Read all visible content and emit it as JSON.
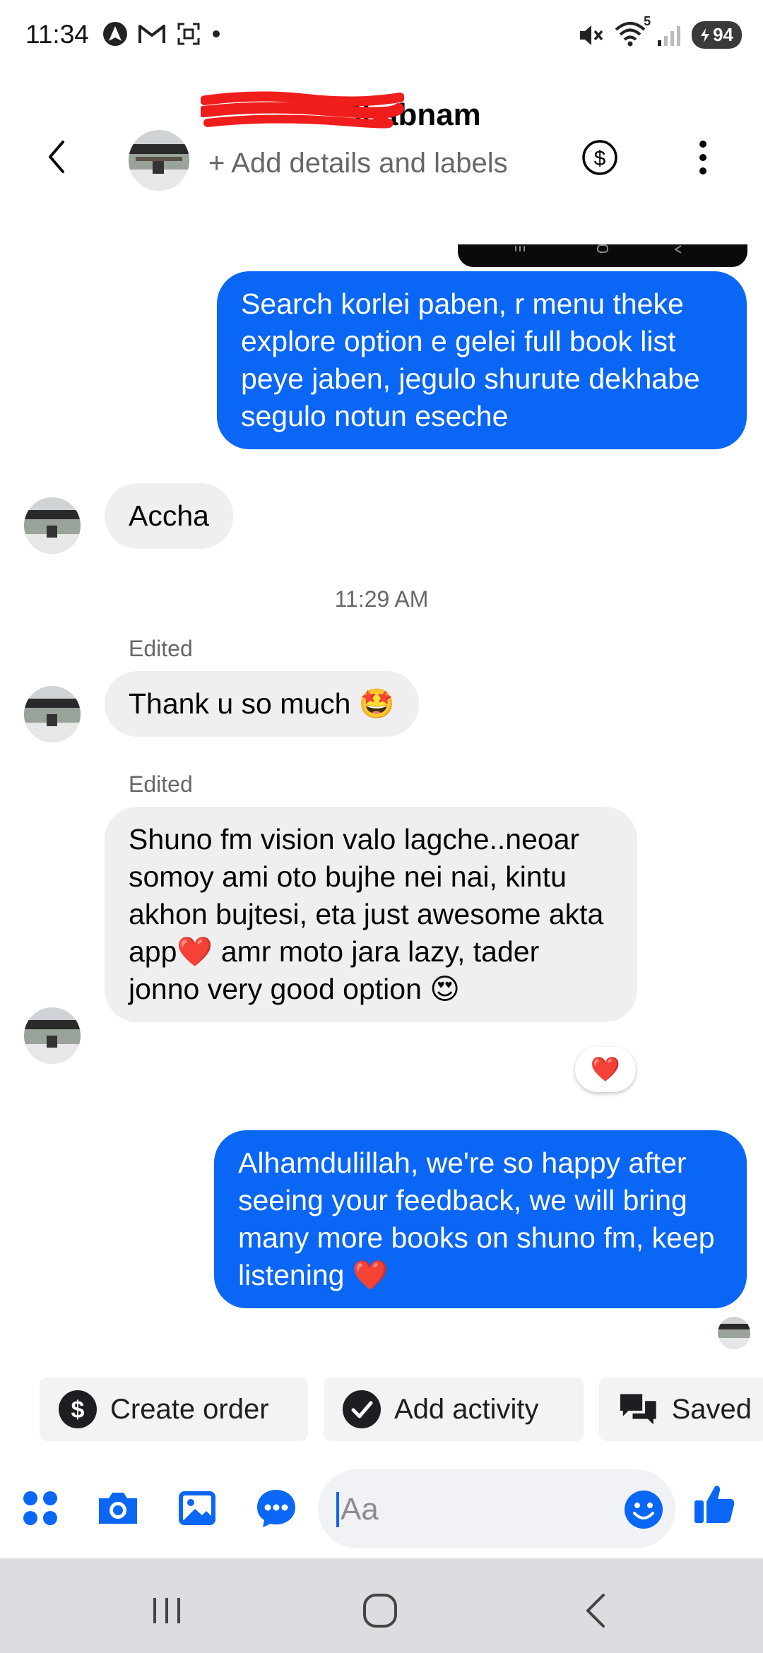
{
  "status_bar": {
    "time": "11:34",
    "battery": "94",
    "wifi_badge": "5"
  },
  "header": {
    "contact_name": "Shabnam",
    "add_details": "+ Add details and labels"
  },
  "messages": [
    {
      "direction": "outgoing",
      "text": "Search korlei paben, r menu theke explore option e gelei full book list peye jaben, jegulo shurute dekhabe segulo notun eseche"
    },
    {
      "direction": "incoming",
      "text": "Accha"
    },
    {
      "direction": "timestamp",
      "text": "11:29 AM"
    },
    {
      "direction": "incoming",
      "edited_label": "Edited",
      "text": "Thank u so much 🤩"
    },
    {
      "direction": "incoming",
      "edited_label": "Edited",
      "text": "Shuno fm  vision valo lagche..neoar somoy ami oto bujhe nei nai, kintu akhon bujtesi, eta just awesome akta  app❤️ amr moto jara lazy,  tader jonno very good option 😍",
      "reaction": "❤️"
    },
    {
      "direction": "outgoing",
      "text": "Alhamdulillah, we're so happy after seeing your feedback, we will bring many more books on shuno fm, keep listening ❤️"
    }
  ],
  "quick_actions": [
    {
      "label": "Create order",
      "icon": "dollar-icon"
    },
    {
      "label": "Add activity",
      "icon": "check-circle-icon"
    },
    {
      "label": "Saved",
      "icon": "chat-bubbles-icon"
    }
  ],
  "composer": {
    "placeholder": "Aa",
    "icons": [
      "apps-grid-icon",
      "camera-icon",
      "gallery-icon",
      "chat-more-icon",
      "emoji-icon",
      "thumbs-up-icon"
    ]
  },
  "colors": {
    "messenger_blue": "#0a66f5",
    "incoming_bubble": "#efeff1",
    "secondary_text": "#65676b"
  }
}
